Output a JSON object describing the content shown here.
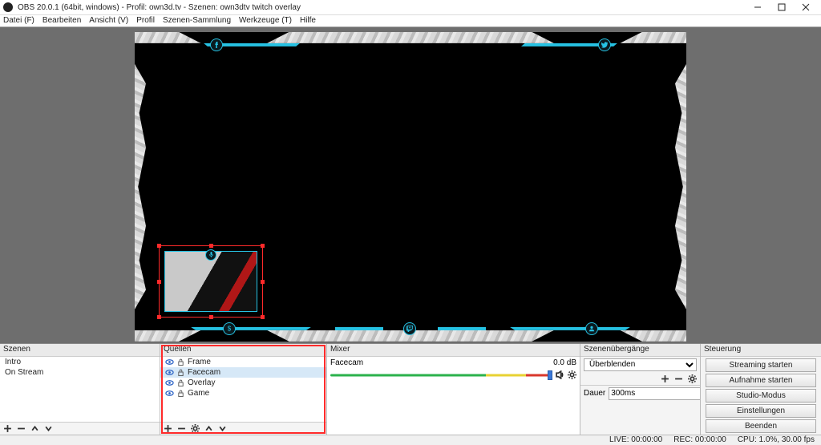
{
  "titlebar": {
    "title": "OBS 20.0.1 (64bit, windows) - Profil: own3d.tv - Szenen: own3dtv twitch overlay"
  },
  "menu": {
    "file": "Datei (F)",
    "edit": "Bearbeiten",
    "view": "Ansicht (V)",
    "profile": "Profil",
    "scene_collection": "Szenen-Sammlung",
    "tools": "Werkzeuge (T)",
    "help": "Hilfe"
  },
  "panels": {
    "scenes": {
      "title": "Szenen",
      "items": [
        "Intro",
        "On Stream"
      ]
    },
    "sources": {
      "title": "Quellen",
      "items": [
        {
          "label": "Frame",
          "selected": false
        },
        {
          "label": "Facecam",
          "selected": true
        },
        {
          "label": "Overlay",
          "selected": false
        },
        {
          "label": "Game",
          "selected": false
        }
      ]
    },
    "mixer": {
      "title": "Mixer",
      "source_name": "Facecam",
      "db": "0.0 dB"
    },
    "transitions": {
      "title": "Szenenübergänge",
      "selected": "Überblenden",
      "duration_label": "Dauer",
      "duration_value": "300ms"
    },
    "controls": {
      "title": "Steuerung",
      "buttons": {
        "start_streaming": "Streaming starten",
        "start_recording": "Aufnahme starten",
        "studio_mode": "Studio-Modus",
        "settings": "Einstellungen",
        "exit": "Beenden"
      }
    }
  },
  "status": {
    "live": "LIVE: 00:00:00",
    "rec": "REC: 00:00:00",
    "cpu": "CPU: 1.0%, 30.00 fps"
  }
}
